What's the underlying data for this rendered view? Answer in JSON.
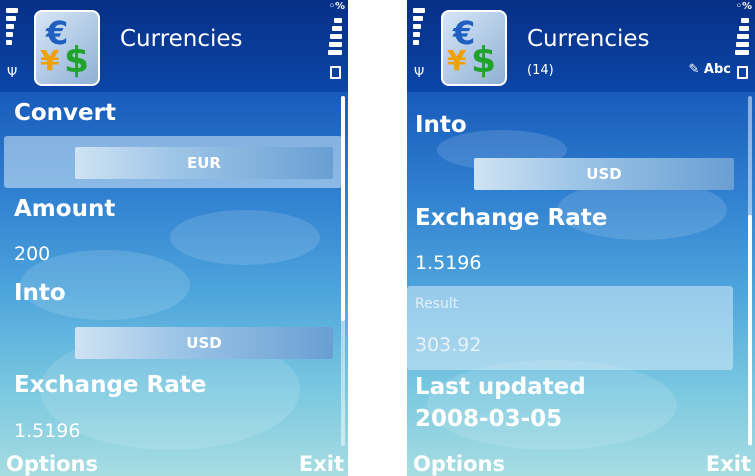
{
  "left_screen": {
    "app_title": "Currencies",
    "fields": {
      "convert_label": "Convert",
      "convert_value": "EUR",
      "amount_label": "Amount",
      "amount_value": "200",
      "into_label": "Into",
      "into_value": "USD",
      "rate_label": "Exchange Rate",
      "rate_value": "1.5196"
    },
    "softkeys": {
      "left": "Options",
      "right": "Exit"
    }
  },
  "right_screen": {
    "app_title": "Currencies",
    "count": "(14)",
    "input_mode": "Abc",
    "fields": {
      "into_label": "Into",
      "into_value": "USD",
      "rate_label": "Exchange Rate",
      "rate_value": "1.5196",
      "result_label": "Result",
      "result_value": "303.92",
      "updated_label": "Last updated",
      "updated_value": "2008-03-05"
    },
    "softkeys": {
      "left": "Options",
      "right": "Exit"
    }
  },
  "icons": {
    "signal": "signal-strength-icon",
    "antenna": "antenna-icon",
    "battery": "battery-icon",
    "app": "currency-app-icon",
    "pen": "pen-input-icon"
  }
}
